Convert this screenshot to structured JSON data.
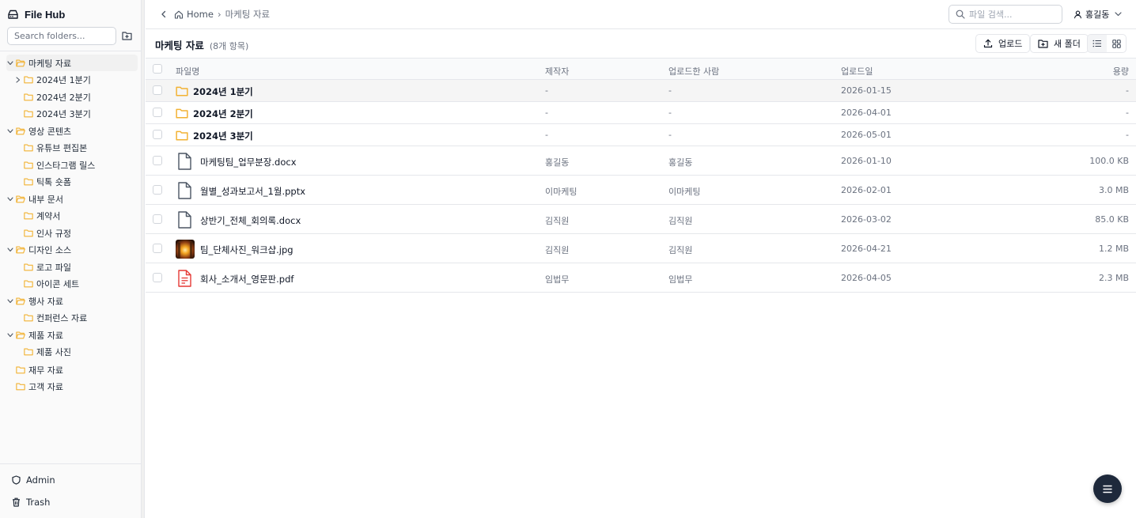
{
  "app": {
    "title": "File Hub"
  },
  "sidebar": {
    "search_placeholder": "Search folders...",
    "tree": [
      {
        "label": "마케팅 자료",
        "depth": 0,
        "expanded": true,
        "active": true
      },
      {
        "label": "2024년 1분기",
        "depth": 1,
        "collapsed": true
      },
      {
        "label": "2024년 2분기",
        "depth": 1
      },
      {
        "label": "2024년 3분기",
        "depth": 1
      },
      {
        "label": "영상 콘텐츠",
        "depth": 0,
        "expanded": true
      },
      {
        "label": "유튜브 편집본",
        "depth": 1
      },
      {
        "label": "인스타그램 릴스",
        "depth": 1
      },
      {
        "label": "틱톡 숏폼",
        "depth": 1
      },
      {
        "label": "내부 문서",
        "depth": 0,
        "expanded": true
      },
      {
        "label": "계약서",
        "depth": 1
      },
      {
        "label": "인사 규정",
        "depth": 1
      },
      {
        "label": "디자인 소스",
        "depth": 0,
        "expanded": true
      },
      {
        "label": "로고 파일",
        "depth": 1
      },
      {
        "label": "아이콘 세트",
        "depth": 1
      },
      {
        "label": "행사 자료",
        "depth": 0,
        "expanded": true
      },
      {
        "label": "컨퍼런스 자료",
        "depth": 1
      },
      {
        "label": "제품 자료",
        "depth": 0,
        "expanded": true
      },
      {
        "label": "제품 사진",
        "depth": 1
      },
      {
        "label": "재무 자료",
        "depth": 0
      },
      {
        "label": "고객 자료",
        "depth": 0
      }
    ],
    "footer": {
      "admin": "Admin",
      "trash": "Trash"
    }
  },
  "topbar": {
    "breadcrumb": {
      "home": "Home",
      "separator": "›",
      "current": "마케팅 자료"
    },
    "search_placeholder": "파일 검색...",
    "user": "홍길동"
  },
  "toolbar": {
    "folder_name": "마케팅 자료",
    "item_count": "(8개 항목)",
    "upload_label": "업로드",
    "new_folder_label": "새 폴더",
    "view_mode": "list"
  },
  "table": {
    "headers": {
      "name": "파일명",
      "creator": "제작자",
      "uploader": "업로드한 사람",
      "date": "업로드일",
      "size": "용량"
    },
    "rows": [
      {
        "kind": "folder",
        "name": "2024년 1분기",
        "creator": "-",
        "uploader": "-",
        "date": "2026-01-15",
        "size": "-",
        "highlight": true
      },
      {
        "kind": "folder",
        "name": "2024년 2분기",
        "creator": "-",
        "uploader": "-",
        "date": "2026-04-01",
        "size": "-"
      },
      {
        "kind": "folder",
        "name": "2024년 3분기",
        "creator": "-",
        "uploader": "-",
        "date": "2026-05-01",
        "size": "-"
      },
      {
        "kind": "doc",
        "name": "마케팅팀_업무분장.docx",
        "creator": "홍길동",
        "uploader": "홍길동",
        "date": "2026-01-10",
        "size": "100.0 KB"
      },
      {
        "kind": "doc",
        "name": "월별_성과보고서_1월.pptx",
        "creator": "이마케팅",
        "uploader": "이마케팅",
        "date": "2026-02-01",
        "size": "3.0 MB"
      },
      {
        "kind": "doc",
        "name": "상반기_전체_회의록.docx",
        "creator": "김직원",
        "uploader": "김직원",
        "date": "2026-03-02",
        "size": "85.0 KB"
      },
      {
        "kind": "image",
        "name": "팀_단체사진_워크샵.jpg",
        "creator": "김직원",
        "uploader": "김직원",
        "date": "2026-04-21",
        "size": "1.2 MB"
      },
      {
        "kind": "pdf",
        "name": "회사_소개서_영문판.pdf",
        "creator": "임법무",
        "uploader": "임법무",
        "date": "2026-04-05",
        "size": "2.3 MB"
      }
    ]
  },
  "colors": {
    "folder": "#f2b233",
    "pdf": "#e53935",
    "fab": "#1e293b",
    "row_highlight": "#f5f5f5"
  },
  "icons": {
    "brand": "hard-drive-icon",
    "new_folder": "folder-plus-icon",
    "back": "chevron-left-icon",
    "home": "home-icon",
    "search": "search-icon",
    "user": "user-icon",
    "upload": "upload-icon",
    "list_view": "list-icon",
    "grid_view": "grid-icon",
    "admin": "shield-icon",
    "trash": "trash-icon",
    "fab": "menu-icon"
  }
}
